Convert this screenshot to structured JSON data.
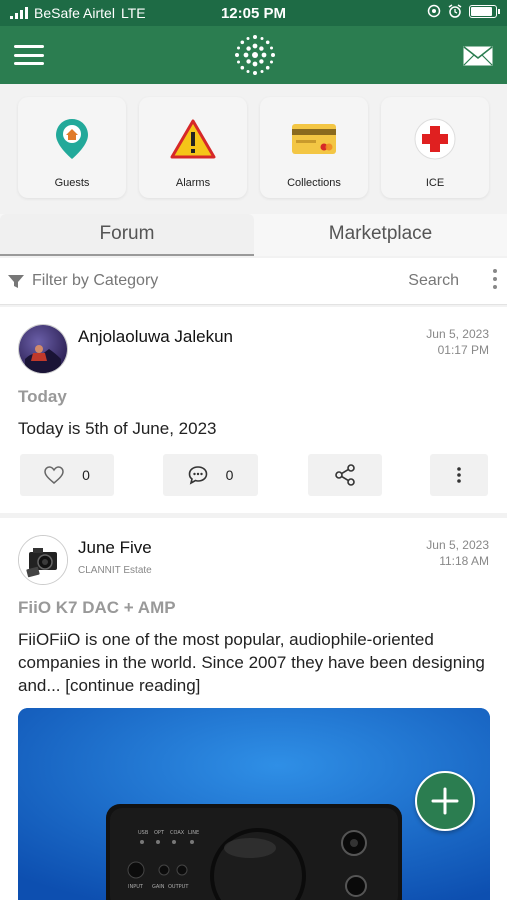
{
  "status": {
    "carrier": "BeSafe Airtel",
    "network": "LTE",
    "time": "12:05 PM"
  },
  "header": {
    "menu_icon": "hamburger-icon",
    "logo_icon": "app-logo-icon",
    "mail_icon": "mail-icon",
    "brand_color": "#2b7d50"
  },
  "tiles": [
    {
      "label": "Guests",
      "icon": "location-pin-icon"
    },
    {
      "label": "Alarms",
      "icon": "warning-icon"
    },
    {
      "label": "Collections",
      "icon": "credit-card-icon"
    },
    {
      "label": "ICE",
      "icon": "red-cross-icon"
    }
  ],
  "tabs": {
    "forum": "Forum",
    "marketplace": "Marketplace"
  },
  "filter": {
    "label": "Filter by Category",
    "search": "Search"
  },
  "posts": [
    {
      "author": "Anjolaoluwa Jalekun",
      "date": "Jun 5, 2023",
      "time": "01:17 PM",
      "title": "Today",
      "body": "Today is 5th of June, 2023",
      "likes": "0",
      "comments": "0"
    },
    {
      "author": "June Five",
      "estate": "CLANNIT Estate",
      "date": "Jun 5, 2023",
      "time": "11:18 AM",
      "title": "FiiO K7 DAC + AMP",
      "body": "FiiOFiiO is one of the most popular, audiophile-oriented companies in the world. Since 2007 they have been designing and... [continue reading]"
    }
  ]
}
